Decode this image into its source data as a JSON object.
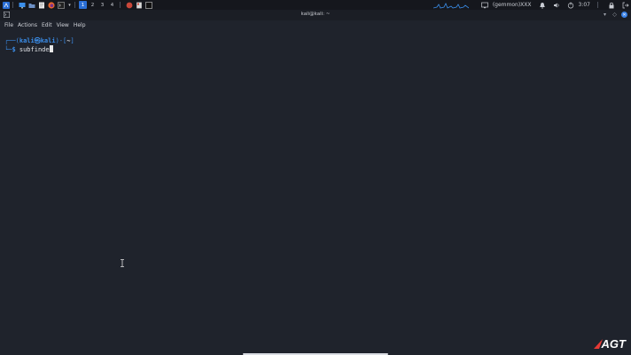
{
  "panel": {
    "workspaces": [
      "1",
      "2",
      "3",
      "4"
    ],
    "active_workspace": 0,
    "status_text": "(gemmon)XXX",
    "clock": "3:07"
  },
  "window": {
    "title": "kali@kali: ~"
  },
  "menu": {
    "items": [
      "File",
      "Actions",
      "Edit",
      "View",
      "Help"
    ]
  },
  "terminal": {
    "prompt_open": "┌──(",
    "prompt_user": "kali㉿kali",
    "prompt_close": ")-[",
    "prompt_dir": "~",
    "prompt_end": "]",
    "prompt2_corner": "└─",
    "prompt2_dollar": "$",
    "command": "subfinde"
  },
  "watermark": {
    "text": "AGT"
  },
  "colors": {
    "accent": "#3b8eea",
    "background": "#1f232c",
    "panel": "#15171d",
    "brand_red": "#e53935"
  }
}
